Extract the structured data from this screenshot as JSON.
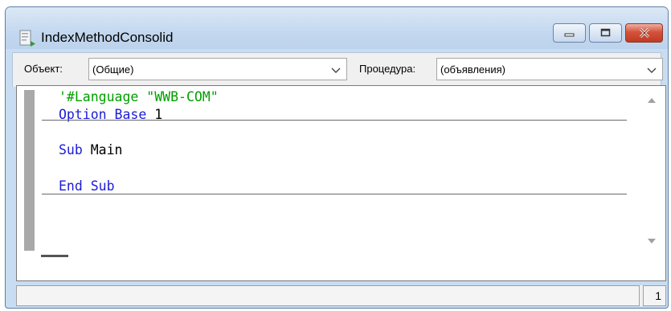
{
  "window": {
    "title": "IndexMethodConsolid",
    "buttons": {
      "minimize": "minimize",
      "maximize": "maximize",
      "close": "close"
    }
  },
  "toolbar": {
    "object_label": "Объект:",
    "object_value": "(Общие)",
    "procedure_label": "Процедура:",
    "procedure_value": "(объявления)"
  },
  "code": {
    "lines": [
      {
        "tokens": [
          {
            "text": "'#Language \"WWB-COM\"",
            "kind": "comment"
          }
        ]
      },
      {
        "tokens": [
          {
            "text": "Option",
            "kind": "keyword"
          },
          {
            "text": " ",
            "kind": "text"
          },
          {
            "text": "Base",
            "kind": "keyword"
          },
          {
            "text": " 1",
            "kind": "text"
          }
        ]
      },
      {
        "tokens": [
          {
            "text": "Sub",
            "kind": "keyword"
          },
          {
            "text": " Main",
            "kind": "text"
          }
        ]
      },
      {
        "tokens": [
          {
            "text": "End",
            "kind": "keyword"
          },
          {
            "text": " ",
            "kind": "text"
          },
          {
            "text": "Sub",
            "kind": "keyword"
          }
        ]
      }
    ],
    "colors": {
      "comment": "#00a000",
      "keyword": "#1b1bd6",
      "text": "#000000"
    }
  },
  "status": {
    "main_text": "",
    "page": "1"
  }
}
